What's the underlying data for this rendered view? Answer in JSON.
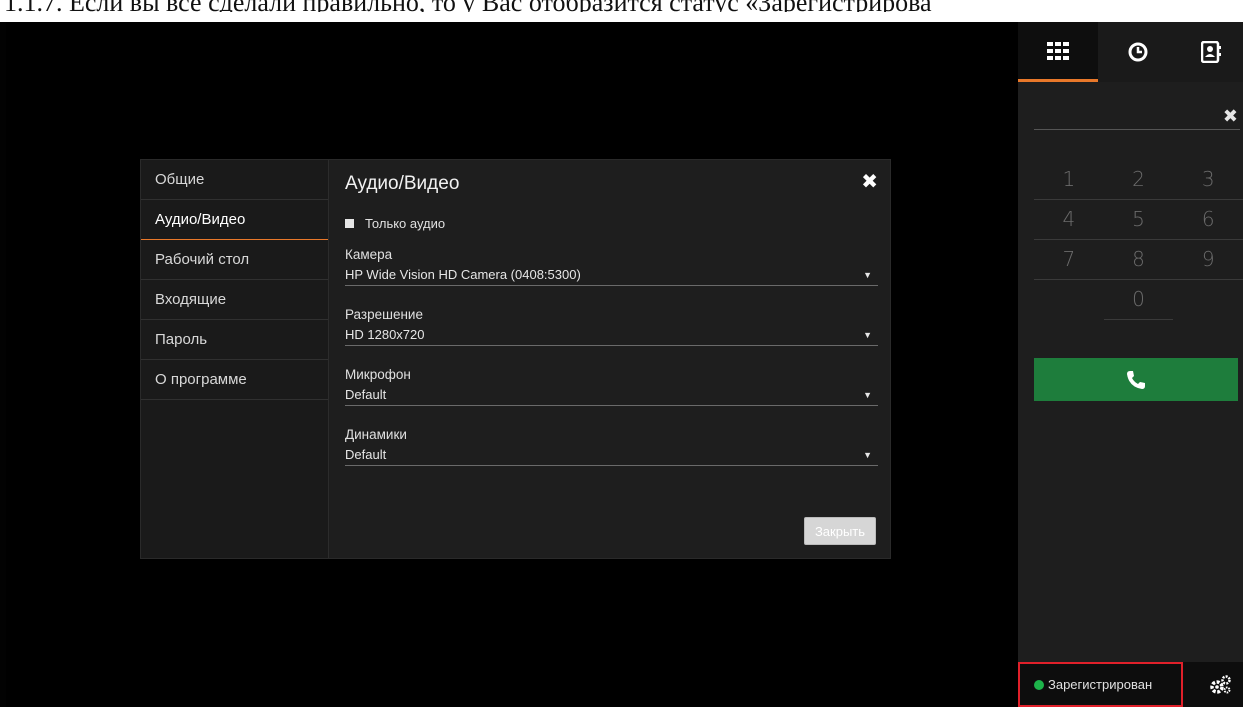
{
  "doc": {
    "caption": "1.1.7. Если вы все сделали правильно, то у Вас отобразится статус «Зарегистрирова"
  },
  "dialog": {
    "title": "Аудио/Видео",
    "nav": [
      {
        "label": "Общие"
      },
      {
        "label": "Аудио/Видео"
      },
      {
        "label": "Рабочий стол"
      },
      {
        "label": "Входящие"
      },
      {
        "label": "Пароль"
      },
      {
        "label": "О программе"
      }
    ],
    "active_nav": "Аудио/Видео",
    "audio_only_label": "Только аудио",
    "fields": {
      "camera": {
        "label": "Камера",
        "value": "HP Wide Vision HD Camera (0408:5300)"
      },
      "resolution": {
        "label": "Разрешение",
        "value": "HD 1280x720"
      },
      "microphone": {
        "label": "Микрофон",
        "value": "Default"
      },
      "speakers": {
        "label": "Динамики",
        "value": "Default"
      }
    },
    "close_label": "Закрыть"
  },
  "panel": {
    "keys": [
      [
        "1",
        "2",
        "3"
      ],
      [
        "4",
        "5",
        "6"
      ],
      [
        "7",
        "8",
        "9"
      ],
      [
        "",
        "0",
        ""
      ]
    ],
    "status_text": "Зарегистрирован",
    "colors": {
      "accent": "#e8782a",
      "call_button": "#1e7d3c",
      "status_online": "#1db34a",
      "highlight_box": "#e0202a"
    }
  }
}
